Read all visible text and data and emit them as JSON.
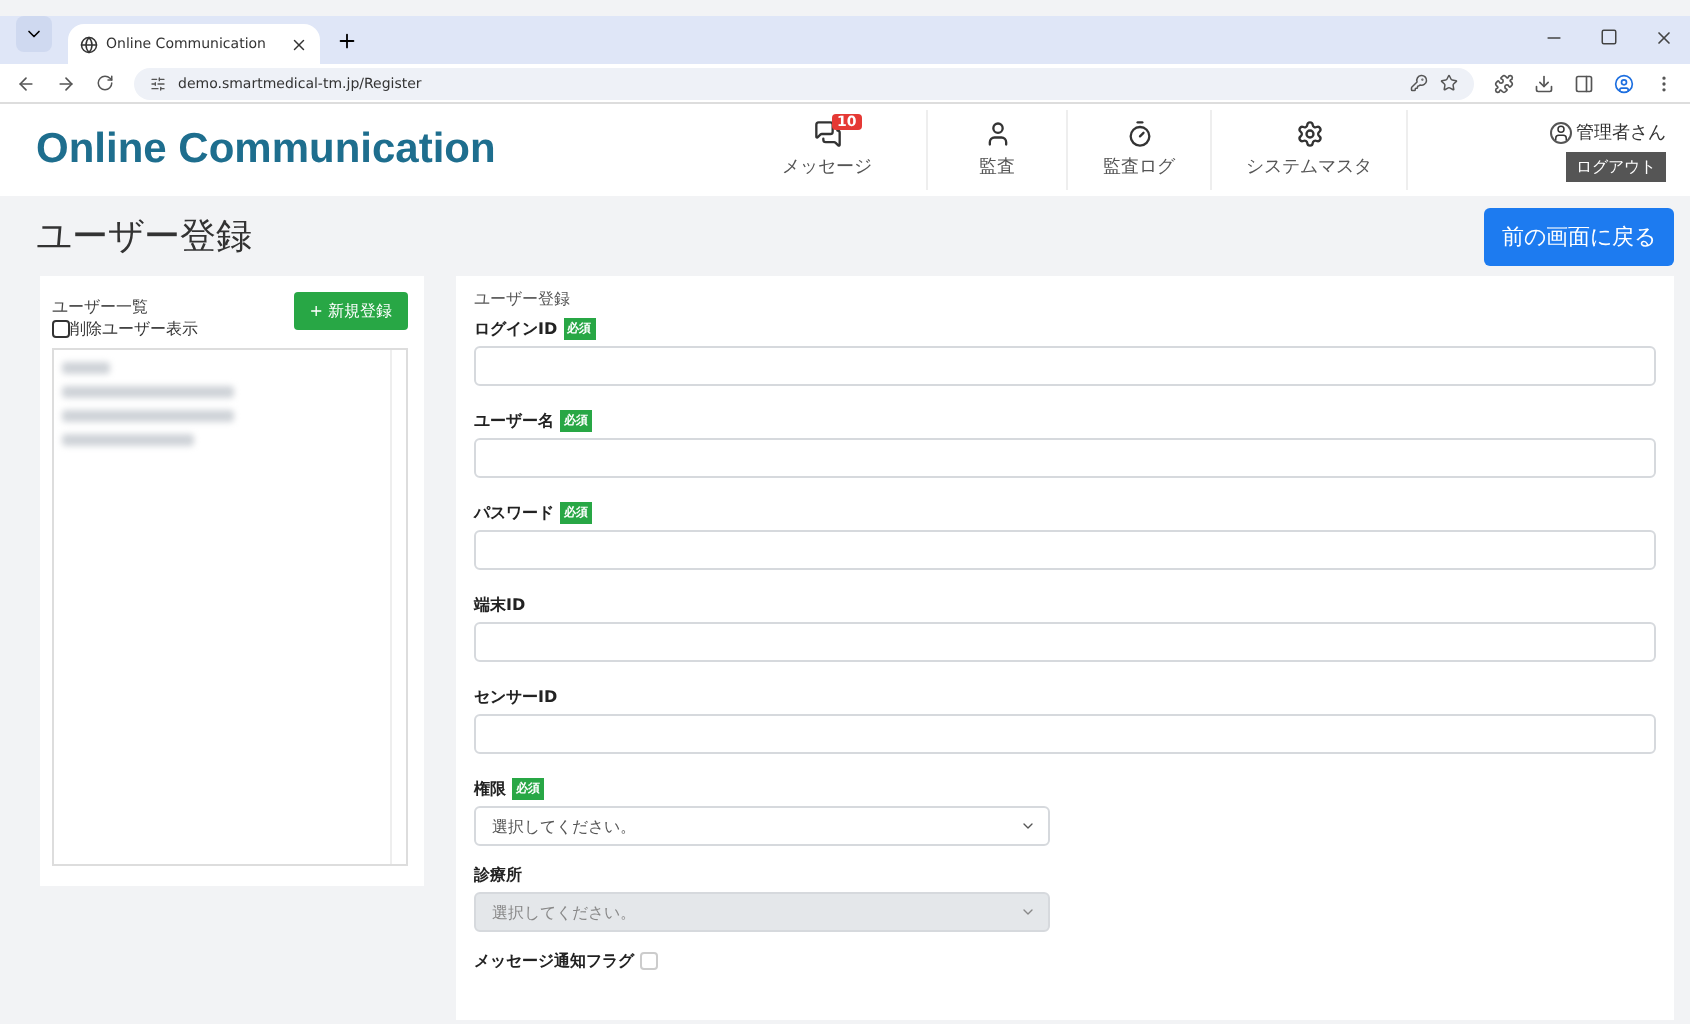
{
  "browser": {
    "tab_title": "Online Communication",
    "url": "demo.smartmedical-tm.jp/Register"
  },
  "header": {
    "brand": "Online Communication",
    "nav": [
      {
        "label": "メッセージ",
        "badge": "10"
      },
      {
        "label": "監査"
      },
      {
        "label": "監査ログ"
      },
      {
        "label": "システムマスタ"
      }
    ],
    "user": "管理者さん",
    "logout": "ログアウト"
  },
  "page_title": "ユーザー登録",
  "back_button": "前の画面に戻る",
  "user_list": {
    "title": "ユーザー一覧",
    "new_button": "+ 新規登録",
    "show_deleted": {
      "label": "削除ユーザー表示",
      "checked": false
    }
  },
  "form": {
    "title": "ユーザー登録",
    "fields": [
      {
        "kind": "text",
        "label": "ログインID",
        "required_badge": "必須"
      },
      {
        "kind": "text",
        "label": "ユーザー名",
        "required_badge": "必須"
      },
      {
        "kind": "text",
        "label": "パスワード",
        "required_badge": "必須"
      },
      {
        "kind": "text",
        "label": "端末ID"
      },
      {
        "kind": "text",
        "label": "センサーID"
      },
      {
        "kind": "select",
        "label": "権限",
        "required_badge": "必須",
        "placeholder": "選択してください。",
        "disabled": false
      },
      {
        "kind": "select",
        "label": "診療所",
        "placeholder": "選択してください。",
        "disabled": true
      },
      {
        "kind": "checkbox",
        "label": "メッセージ通知フラグ",
        "checked": false
      }
    ]
  }
}
